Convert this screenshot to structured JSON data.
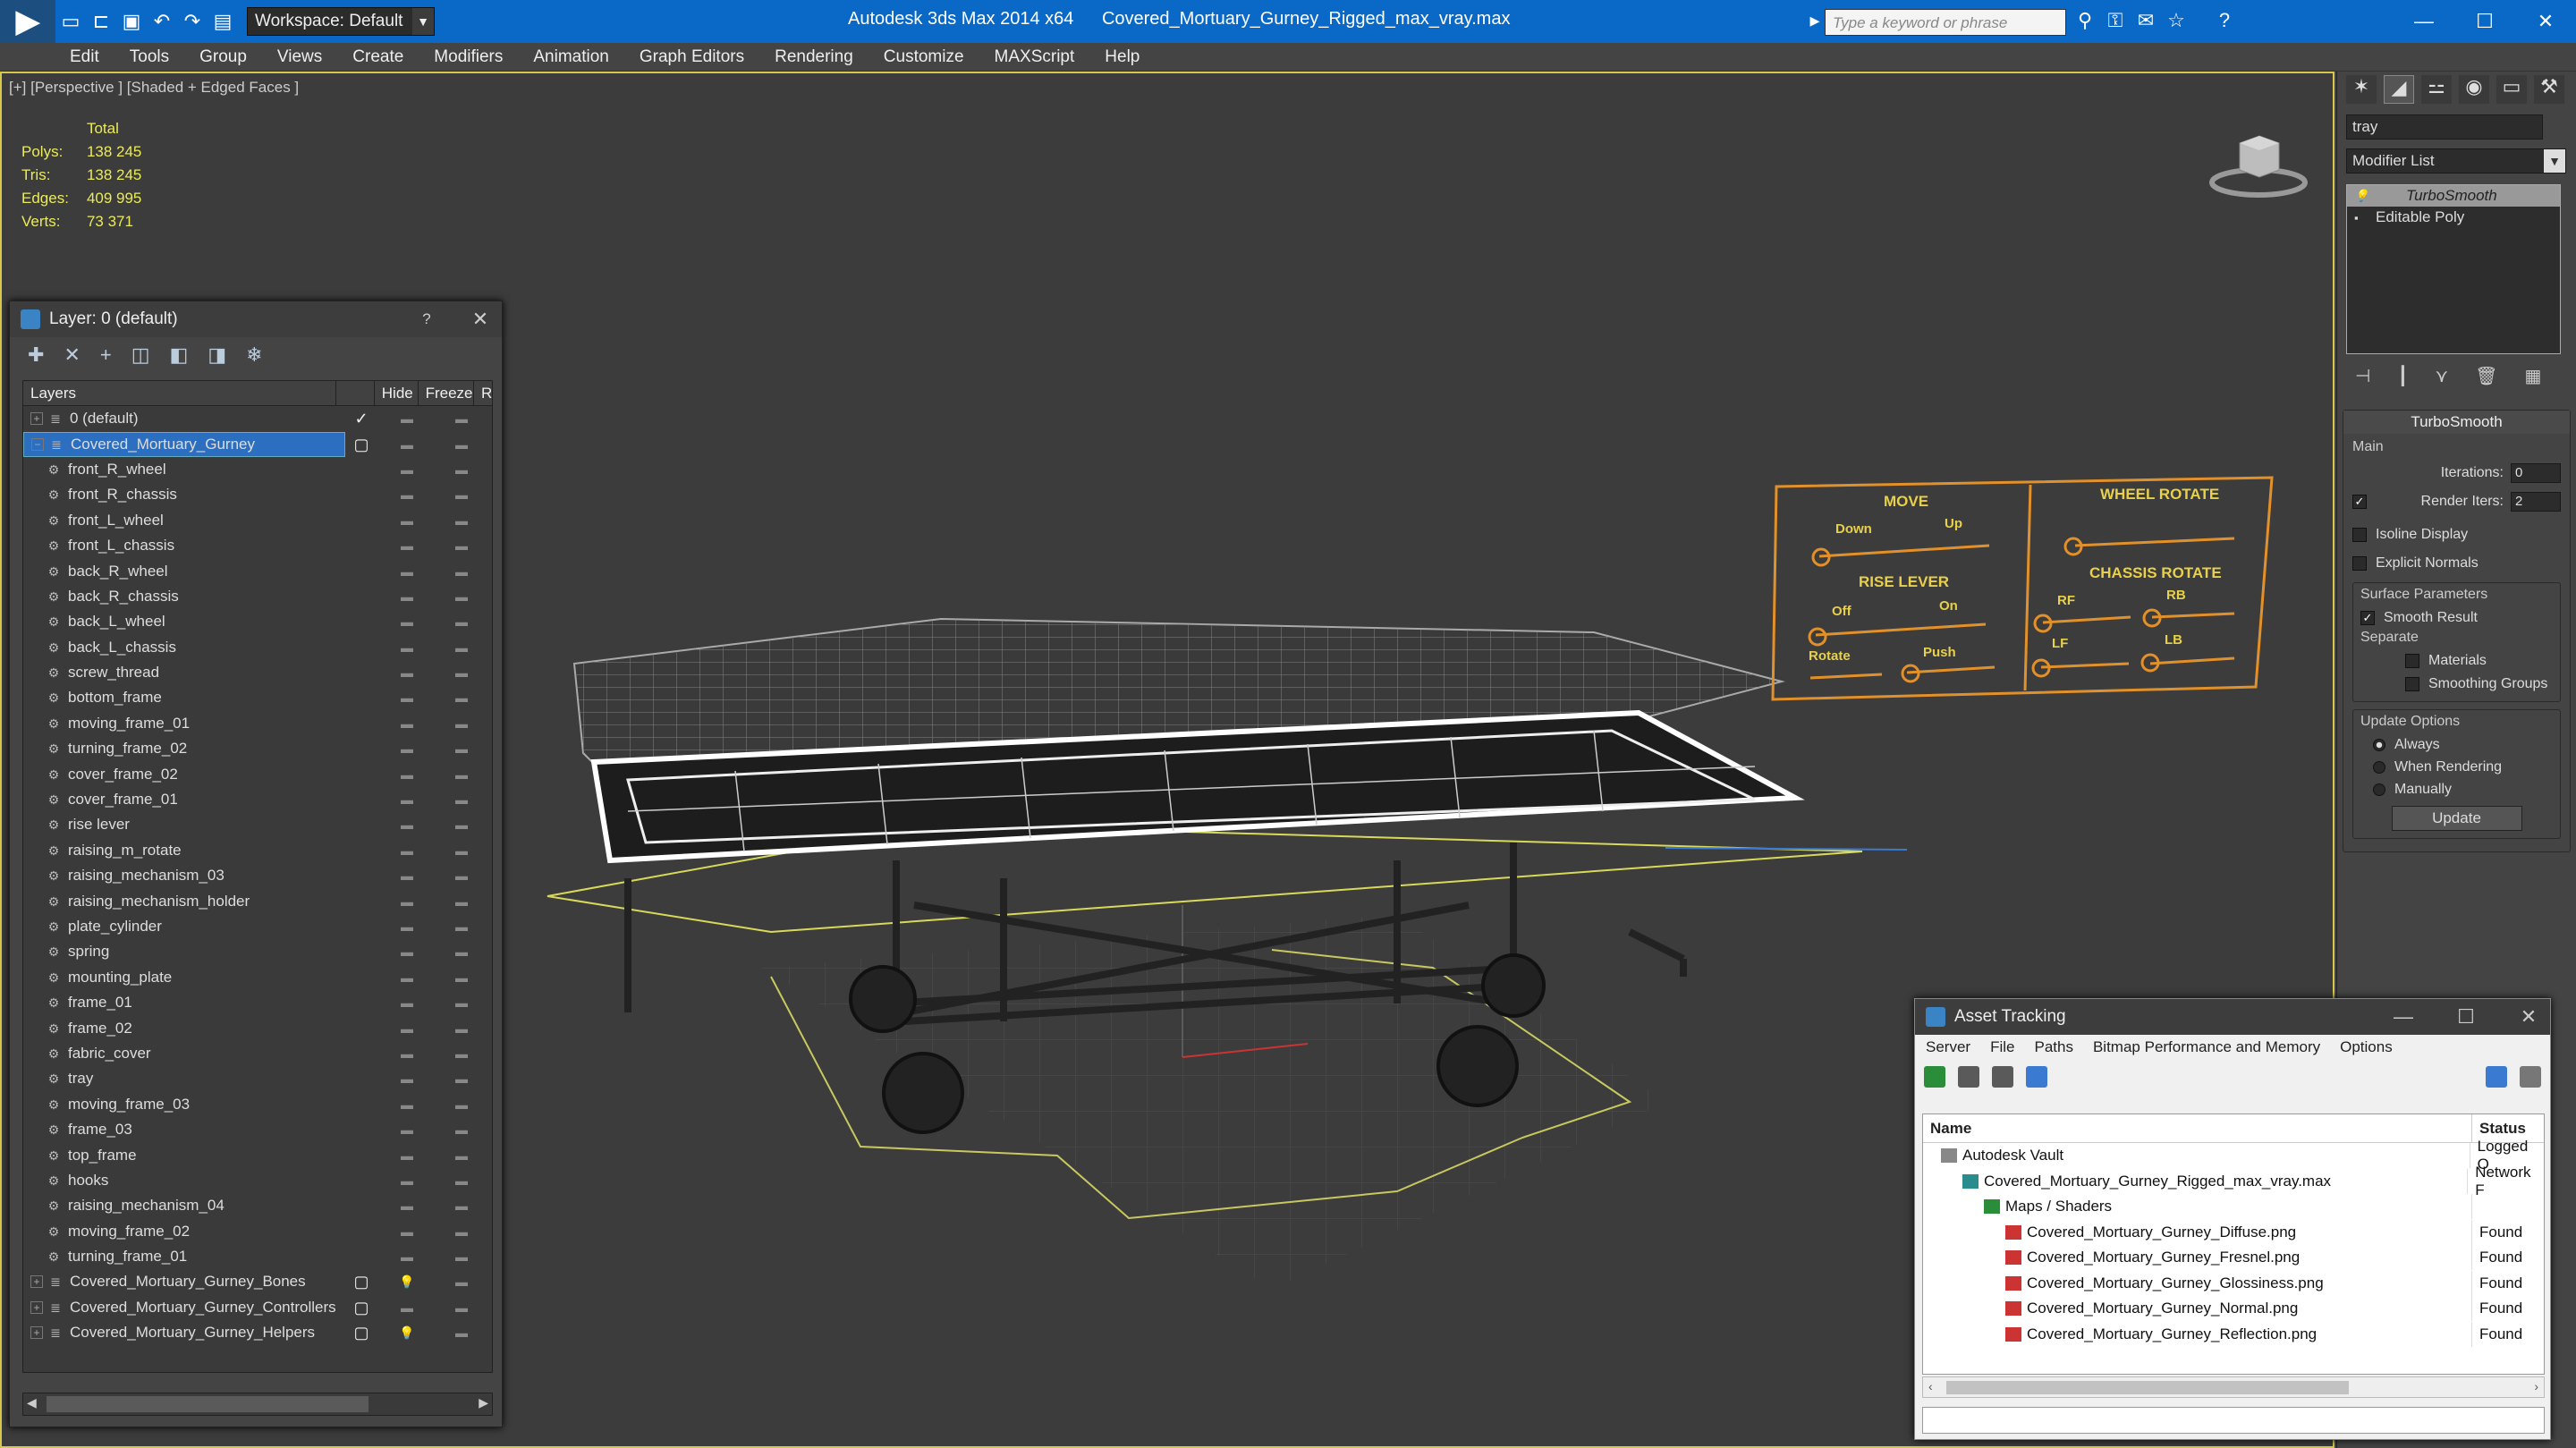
{
  "title_bar": {
    "app_title": "Autodesk 3ds Max  2014 x64",
    "file_title": "Covered_Mortuary_Gurney_Rigged_max_vray.max",
    "workspace": "Workspace: Default",
    "search_placeholder": "Type a keyword or phrase"
  },
  "menu": [
    "Edit",
    "Tools",
    "Group",
    "Views",
    "Create",
    "Modifiers",
    "Animation",
    "Graph Editors",
    "Rendering",
    "Customize",
    "MAXScript",
    "Help"
  ],
  "viewport": {
    "label": "[+] [Perspective ] [Shaded + Edged Faces ]",
    "stats_header": "Total",
    "stats": [
      {
        "label": "Polys:",
        "value": "138 245"
      },
      {
        "label": "Tris:",
        "value": "138 245"
      },
      {
        "label": "Edges:",
        "value": "409 995"
      },
      {
        "label": "Verts:",
        "value": "73 371"
      }
    ]
  },
  "control_panel": {
    "move_title": "MOVE",
    "move_down": "Down",
    "move_up": "Up",
    "rise_title": "RISE LEVER",
    "rise_off": "Off",
    "rise_on": "On",
    "rotate": "Rotate",
    "push": "Push",
    "wheel_title": "WHEEL ROTATE",
    "chassis_title": "CHASSIS ROTATE",
    "rf": "RF",
    "rb": "RB",
    "lf": "LF",
    "lb": "LB"
  },
  "layer_panel": {
    "title": "Layer: 0 (default)",
    "help": "?",
    "col_layers": "Layers",
    "col_hide": "Hide",
    "col_freeze": "Freeze",
    "col_r": "R",
    "rows": [
      {
        "name": "0 (default)",
        "level": 0,
        "type": "layer",
        "current": true
      },
      {
        "name": "Covered_Mortuary_Gurney",
        "level": 0,
        "type": "layer",
        "selected": true,
        "expanded": true
      },
      {
        "name": "front_R_wheel",
        "level": 1
      },
      {
        "name": "front_R_chassis",
        "level": 1
      },
      {
        "name": "front_L_wheel",
        "level": 1
      },
      {
        "name": "front_L_chassis",
        "level": 1
      },
      {
        "name": "back_R_wheel",
        "level": 1
      },
      {
        "name": "back_R_chassis",
        "level": 1
      },
      {
        "name": "back_L_wheel",
        "level": 1
      },
      {
        "name": "back_L_chassis",
        "level": 1
      },
      {
        "name": "screw_thread",
        "level": 1
      },
      {
        "name": "bottom_frame",
        "level": 1
      },
      {
        "name": "moving_frame_01",
        "level": 1
      },
      {
        "name": "turning_frame_02",
        "level": 1
      },
      {
        "name": "cover_frame_02",
        "level": 1
      },
      {
        "name": "cover_frame_01",
        "level": 1
      },
      {
        "name": "rise lever",
        "level": 1
      },
      {
        "name": "raising_m_rotate",
        "level": 1
      },
      {
        "name": "raising_mechanism_03",
        "level": 1
      },
      {
        "name": "raising_mechanism_holder",
        "level": 1
      },
      {
        "name": "plate_cylinder",
        "level": 1
      },
      {
        "name": "spring",
        "level": 1
      },
      {
        "name": "mounting_plate",
        "level": 1
      },
      {
        "name": "frame_01",
        "level": 1
      },
      {
        "name": "frame_02",
        "level": 1
      },
      {
        "name": "fabric_cover",
        "level": 1
      },
      {
        "name": "tray",
        "level": 1
      },
      {
        "name": "moving_frame_03",
        "level": 1
      },
      {
        "name": "frame_03",
        "level": 1
      },
      {
        "name": "top_frame",
        "level": 1
      },
      {
        "name": "hooks",
        "level": 1
      },
      {
        "name": "raising_mechanism_04",
        "level": 1
      },
      {
        "name": "moving_frame_02",
        "level": 1
      },
      {
        "name": "turning_frame_01",
        "level": 1
      },
      {
        "name": "Covered_Mortuary_Gurney_Bones",
        "level": 0,
        "type": "layer",
        "hidden": true
      },
      {
        "name": "Covered_Mortuary_Gurney_Controllers",
        "level": 0,
        "type": "layer"
      },
      {
        "name": "Covered_Mortuary_Gurney_Helpers",
        "level": 0,
        "type": "layer",
        "hidden": true
      }
    ]
  },
  "command_panel": {
    "object_name": "tray",
    "modifier_list": "Modifier List",
    "stack": [
      "TurboSmooth",
      "Editable Poly"
    ],
    "rollout_title": "TurboSmooth",
    "main_label": "Main",
    "iterations_label": "Iterations:",
    "iterations_value": "0",
    "render_iters_label": "Render Iters:",
    "render_iters_value": "2",
    "isoline": "Isoline Display",
    "explicit_normals": "Explicit Normals",
    "surface_params": "Surface Parameters",
    "smooth_result": "Smooth Result",
    "separate": "Separate",
    "materials": "Materials",
    "smoothing_groups": "Smoothing Groups",
    "update_options": "Update Options",
    "always": "Always",
    "when_rendering": "When Rendering",
    "manually": "Manually",
    "update_button": "Update"
  },
  "asset_tracking": {
    "title": "Asset Tracking",
    "menu": [
      "Server",
      "File",
      "Paths",
      "Bitmap Performance and Memory",
      "Options"
    ],
    "col_name": "Name",
    "col_status": "Status",
    "rows": [
      {
        "name": "Autodesk Vault",
        "status": "Logged O",
        "level": 1,
        "icon": "vault-icon"
      },
      {
        "name": "Covered_Mortuary_Gurney_Rigged_max_vray.max",
        "status": "Network F",
        "level": 2,
        "icon": "max-file-icon"
      },
      {
        "name": "Maps / Shaders",
        "status": "",
        "level": 3,
        "icon": "maps-icon"
      },
      {
        "name": "Covered_Mortuary_Gurney_Diffuse.png",
        "status": "Found",
        "level": 4,
        "icon": "png-icon"
      },
      {
        "name": "Covered_Mortuary_Gurney_Fresnel.png",
        "status": "Found",
        "level": 4,
        "icon": "png-icon"
      },
      {
        "name": "Covered_Mortuary_Gurney_Glossiness.png",
        "status": "Found",
        "level": 4,
        "icon": "png-icon"
      },
      {
        "name": "Covered_Mortuary_Gurney_Normal.png",
        "status": "Found",
        "level": 4,
        "icon": "png-icon"
      },
      {
        "name": "Covered_Mortuary_Gurney_Reflection.png",
        "status": "Found",
        "level": 4,
        "icon": "png-icon"
      }
    ]
  },
  "colors": {
    "titlebar": "#0a69c7",
    "selection": "#2c6fc0",
    "stats": "#eaea5a",
    "control_panel": "#e2902a",
    "viewport_border": "#d8c84a"
  }
}
